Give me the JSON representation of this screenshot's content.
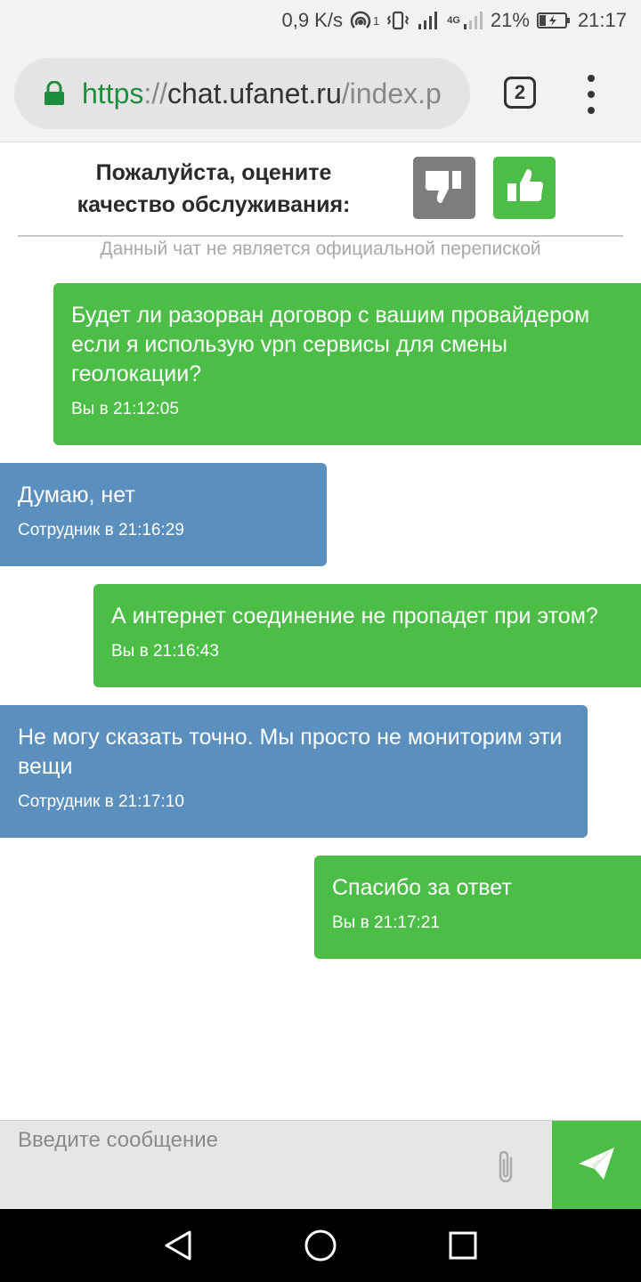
{
  "status_bar": {
    "net_speed": "0,9 K/s",
    "hotspot_badge": "1",
    "network_type": "4G",
    "battery": "21%",
    "time": "21:17"
  },
  "browser": {
    "url_scheme": "https",
    "url_sep": "://",
    "url_host": "chat.ufanet.ru",
    "url_path": "/index.p",
    "tab_count": "2"
  },
  "rating": {
    "prompt": "Пожалуйста, оцените качество обслуживания:",
    "bad_icon": "thumbs-down-icon",
    "good_icon": "thumbs-up-icon"
  },
  "disclaimer": "Данный чат не является официальной перепиской",
  "messages": [
    {
      "from": "user",
      "text": "Будет ли разорван договор с вашим провайдером если я использую vpn сервисы для смены геолокации?",
      "meta": "Вы в 21:12:05"
    },
    {
      "from": "staff",
      "text": "Думаю, нет",
      "meta": "Сотрудник в 21:16:29"
    },
    {
      "from": "user",
      "text": "А интернет соединение не пропадет при этом?",
      "meta": "Вы в 21:16:43"
    },
    {
      "from": "staff",
      "text": "Не могу сказать точно. Мы просто не мониторим эти вещи",
      "meta": "Сотрудник в 21:17:10"
    },
    {
      "from": "user",
      "text": "Спасибо за ответ",
      "meta": "Вы в 21:17:21"
    }
  ],
  "composer": {
    "placeholder": "Введите сообщение",
    "value": ""
  },
  "colors": {
    "user_bubble": "#4cbe47",
    "staff_bubble": "#5a8fbe",
    "dislike_button": "#7d7d7d",
    "like_button": "#4cbe47"
  }
}
